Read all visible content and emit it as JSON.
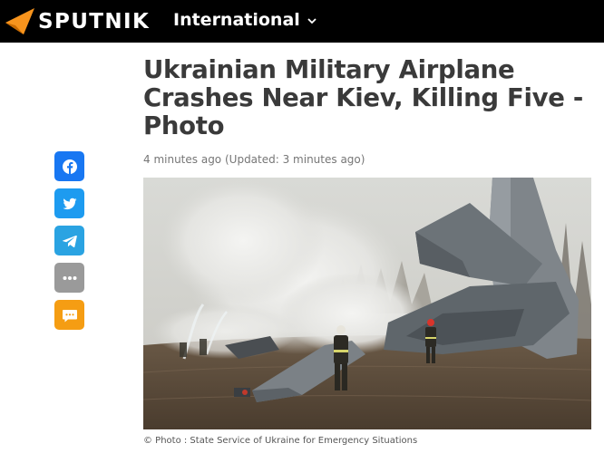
{
  "header": {
    "logo_text": "SPUTNIK",
    "edition_label": "International",
    "colors": {
      "background": "#000000",
      "logo_accent": "#f7941d"
    }
  },
  "article": {
    "title": "Ukrainian Military Airplane Crashes Near Kiev, Killing Five - Photo",
    "published": "4 minutes ago",
    "updated": "(Updated: 3 minutes ago)",
    "photo_caption": "© Photo : State Service of Ukraine for Emergency Situations"
  },
  "share_bar": [
    {
      "icon": "facebook-icon",
      "color": "#1877f2"
    },
    {
      "icon": "twitter-icon",
      "color": "#1d9bf0"
    },
    {
      "icon": "telegram-icon",
      "color": "#2aa3e2"
    },
    {
      "icon": "more-icon",
      "color": "#9a9a9a"
    },
    {
      "icon": "comment-icon",
      "color": "#f59d13"
    }
  ]
}
